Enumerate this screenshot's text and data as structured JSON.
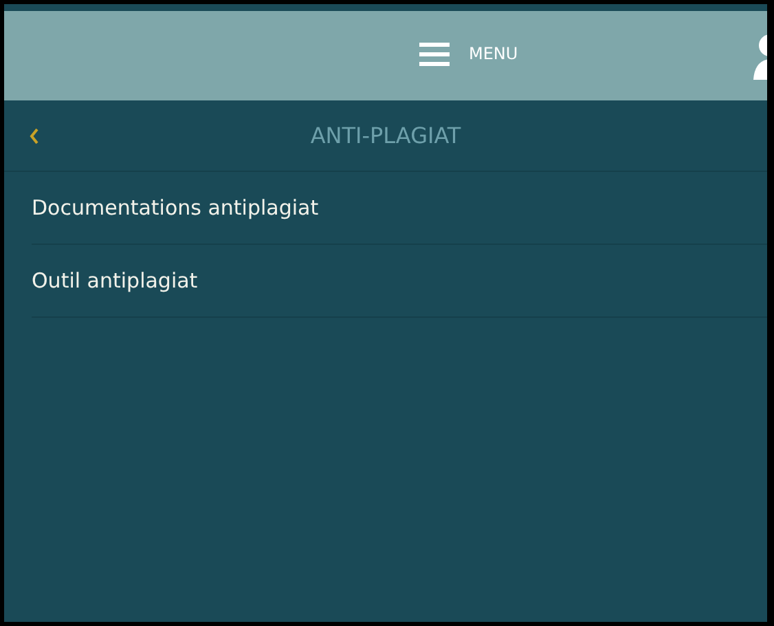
{
  "header": {
    "menu_label": "MENU"
  },
  "submenu": {
    "title": "ANTI-PLAGIAT"
  },
  "items": [
    {
      "label": "Documentations antiplagiat"
    },
    {
      "label": "Outil antiplagiat"
    }
  ]
}
